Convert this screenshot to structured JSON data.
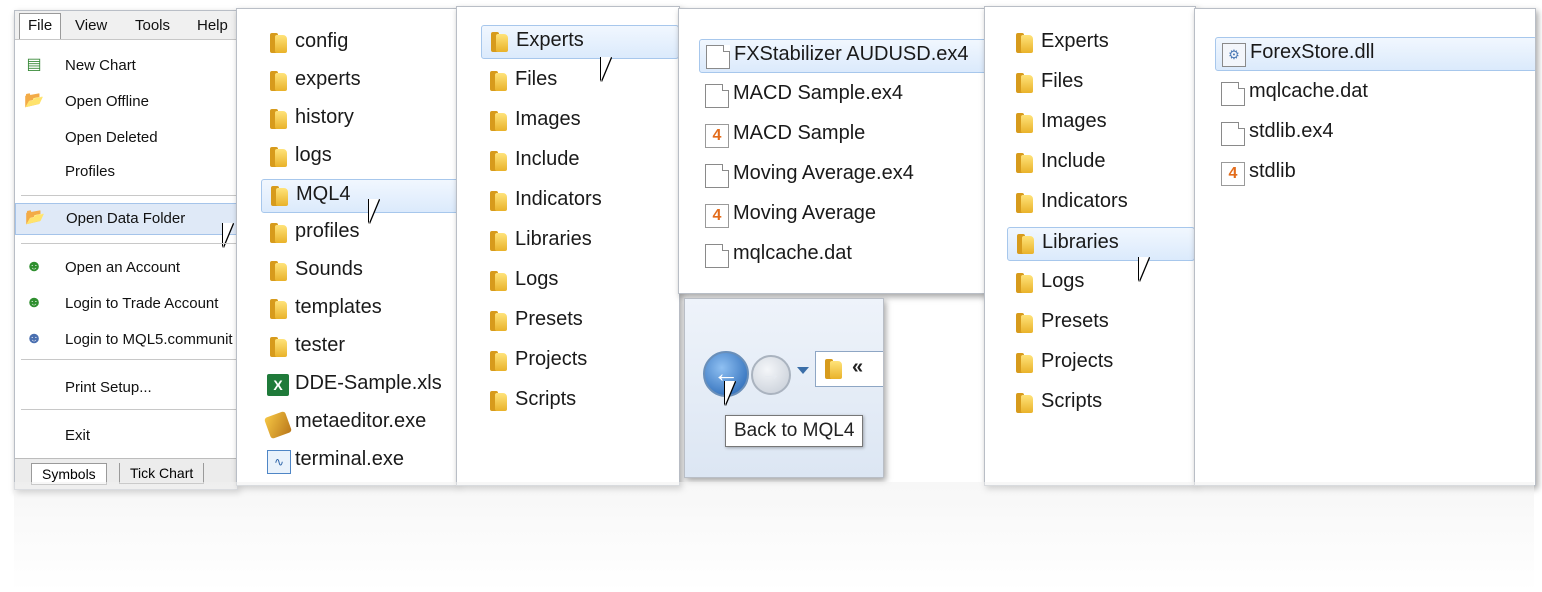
{
  "menu": {
    "bar": [
      "File",
      "View",
      "Tools",
      "Help"
    ],
    "items": [
      {
        "label": "New Chart",
        "icon": "new-chart-icon"
      },
      {
        "label": "Open Offline",
        "icon": "open-folder-icon"
      },
      {
        "label": "Open Deleted",
        "icon": ""
      },
      {
        "label": "Profiles",
        "icon": ""
      },
      {
        "label": "Open Data Folder",
        "icon": "open-folder-icon"
      },
      {
        "label": "Open an Account",
        "icon": "account-icon"
      },
      {
        "label": "Login to Trade Account",
        "icon": "login-icon"
      },
      {
        "label": "Login to MQL5.communit",
        "icon": "mql5-login-icon"
      },
      {
        "label": "Print Setup...",
        "icon": ""
      },
      {
        "label": "Exit",
        "icon": ""
      }
    ],
    "tabs": [
      "Symbols",
      "Tick Chart"
    ]
  },
  "data_folder": {
    "items": [
      {
        "label": "config",
        "type": "folder"
      },
      {
        "label": "experts",
        "type": "folder"
      },
      {
        "label": "history",
        "type": "folder"
      },
      {
        "label": "logs",
        "type": "folder"
      },
      {
        "label": "MQL4",
        "type": "folder",
        "selected": true
      },
      {
        "label": "profiles",
        "type": "folder"
      },
      {
        "label": "Sounds",
        "type": "folder"
      },
      {
        "label": "templates",
        "type": "folder"
      },
      {
        "label": "tester",
        "type": "folder"
      },
      {
        "label": "DDE-Sample.xls",
        "type": "xls"
      },
      {
        "label": "metaeditor.exe",
        "type": "exe1"
      },
      {
        "label": "terminal.exe",
        "type": "exe2"
      }
    ]
  },
  "mql4_folder": {
    "items": [
      {
        "label": "Experts",
        "type": "folder",
        "selected": true
      },
      {
        "label": "Files",
        "type": "folder"
      },
      {
        "label": "Images",
        "type": "folder"
      },
      {
        "label": "Include",
        "type": "folder"
      },
      {
        "label": "Indicators",
        "type": "folder"
      },
      {
        "label": "Libraries",
        "type": "folder"
      },
      {
        "label": "Logs",
        "type": "folder"
      },
      {
        "label": "Presets",
        "type": "folder"
      },
      {
        "label": "Projects",
        "type": "folder"
      },
      {
        "label": "Scripts",
        "type": "folder"
      }
    ]
  },
  "experts_folder": {
    "items": [
      {
        "label": "FXStabilizer AUDUSD.ex4",
        "type": "doc",
        "selected": true
      },
      {
        "label": "MACD Sample.ex4",
        "type": "doc"
      },
      {
        "label": "MACD Sample",
        "type": "src4"
      },
      {
        "label": "Moving Average.ex4",
        "type": "doc"
      },
      {
        "label": "Moving Average",
        "type": "src4"
      },
      {
        "label": "mqlcache.dat",
        "type": "doc"
      }
    ],
    "nav": {
      "back_icon": "back-arrow-icon",
      "forward_icon": "forward-arrow-icon",
      "address_chevron": "«",
      "tooltip": "Back to MQL4"
    }
  },
  "mql4_folder_2": {
    "items": [
      {
        "label": "Experts",
        "type": "folder"
      },
      {
        "label": "Files",
        "type": "folder"
      },
      {
        "label": "Images",
        "type": "folder"
      },
      {
        "label": "Include",
        "type": "folder"
      },
      {
        "label": "Indicators",
        "type": "folder"
      },
      {
        "label": "Libraries",
        "type": "folder",
        "selected": true
      },
      {
        "label": "Logs",
        "type": "folder"
      },
      {
        "label": "Presets",
        "type": "folder"
      },
      {
        "label": "Projects",
        "type": "folder"
      },
      {
        "label": "Scripts",
        "type": "folder"
      }
    ]
  },
  "libraries_folder": {
    "items": [
      {
        "label": "ForexStore.dll",
        "type": "dll",
        "selected": true
      },
      {
        "label": "mqlcache.dat",
        "type": "doc"
      },
      {
        "label": "stdlib.ex4",
        "type": "doc"
      },
      {
        "label": "stdlib",
        "type": "src4"
      }
    ]
  },
  "colors": {
    "selection": "#dbeafc",
    "selection_border": "#a7c7ec",
    "folder": "#e9b22a",
    "source_icon": "#e36c1b"
  }
}
